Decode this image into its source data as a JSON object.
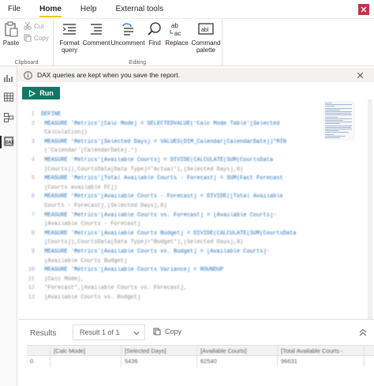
{
  "ribbon_tabs": [
    "File",
    "Home",
    "Help",
    "External tools"
  ],
  "ribbon": {
    "paste": "Paste",
    "cut": "Cut",
    "copy": "Copy",
    "clipboard_group": "Clipboard",
    "format_query": "Format query",
    "comment": "Comment",
    "uncomment": "Uncomment",
    "find": "Find",
    "replace": "Replace",
    "command_palette": "Command palette",
    "editing_group": "Editing"
  },
  "info_bar": {
    "message": "DAX queries are kept when you save the report."
  },
  "run_button": {
    "label": "Run"
  },
  "editor": {
    "lines": [
      {
        "n": "1",
        "text": "DEFINE"
      },
      {
        "n": "2",
        "text": "    MEASURE 'Metrics'[Calc Mode] = SELECTEDVALUE('Calc Mode Table'[Selected"
      },
      {
        "n": "",
        "text": "        Calculation])"
      },
      {
        "n": "3",
        "text": "    MEASURE 'Metrics'[Selected Days] = VALUES(DIM_Calendar[CalendarDate])*MIN"
      },
      {
        "n": "",
        "text": "    ('Calendar'[CalendarDate].*)"
      },
      {
        "n": "4",
        "text": "    MEASURE 'Metrics'[Available Courts] = DIVIDE(CALCULATE(SUM(CourtsData"
      },
      {
        "n": "",
        "text": "        [Courts]),CourtsData[Data Type]=\"Actual\"),[Selected Days],0)"
      },
      {
        "n": "5",
        "text": "    MEASURE 'Metrics'[Total Available Courts - Forecast] = SUM(Fact Forecast"
      },
      {
        "n": "",
        "text": "        [Courts available FC])"
      },
      {
        "n": "6",
        "text": "    MEASURE 'Metrics'[Available Courts - Forecast] = DIVIDE([Total Available"
      },
      {
        "n": "",
        "text": "        Courts - Forecast],[Selected Days],0)"
      },
      {
        "n": "7",
        "text": "    MEASURE 'Metrics'[Available Courts vs. Forecast] = [Available Courts]-"
      },
      {
        "n": "",
        "text": "        [Available Courts - Forecast]"
      },
      {
        "n": "8",
        "text": "    MEASURE 'Metrics'[Available Courts Budget] = DIVIDE(CALCULATE(SUM(CourtsData"
      },
      {
        "n": "",
        "text": "        [Courts]),CourtsData[Data Type]=\"Budget\"),[Selected Days],0)"
      },
      {
        "n": "9",
        "text": "    MEASURE 'Metrics'[Available Courts vs. Budget] = [Available Courts]-"
      },
      {
        "n": "",
        "text": "        [Available Courts Budget]"
      },
      {
        "n": "10",
        "text": "    MEASURE 'Metrics'[Available Courts Variance] = ROUNDUP"
      },
      {
        "n": "11",
        "text": "    [Calc Mode],"
      },
      {
        "n": "12",
        "text": "    \"Forecast\",[Available Courts vs. Forecast],"
      },
      {
        "n": "13",
        "text": "    [Available Courts vs. Budget]"
      }
    ]
  },
  "results": {
    "title": "Results",
    "selector": "Result 1 of 1",
    "copy": "Copy",
    "columns": [
      "",
      "[Calc Mode]",
      "[Selected Days]",
      "[Available Courts]",
      "[Total Available Courts -"
    ],
    "rows": [
      [
        "0",
        "",
        "5436",
        "62540",
        "96631"
      ]
    ]
  },
  "colors": {
    "accent_tab": "#f2c811",
    "run_button": "#117865",
    "keyword": "#1e6fb9"
  },
  "icons": [
    "close-icon",
    "paste-icon",
    "cut-icon",
    "copy-icon",
    "format-query-icon",
    "comment-icon",
    "uncomment-icon",
    "find-icon",
    "replace-icon",
    "command-palette-icon",
    "info-icon",
    "report-view-icon",
    "table-view-icon",
    "model-view-icon",
    "dax-query-view-icon",
    "play-icon",
    "chevron-down-icon",
    "collapse-icon"
  ]
}
